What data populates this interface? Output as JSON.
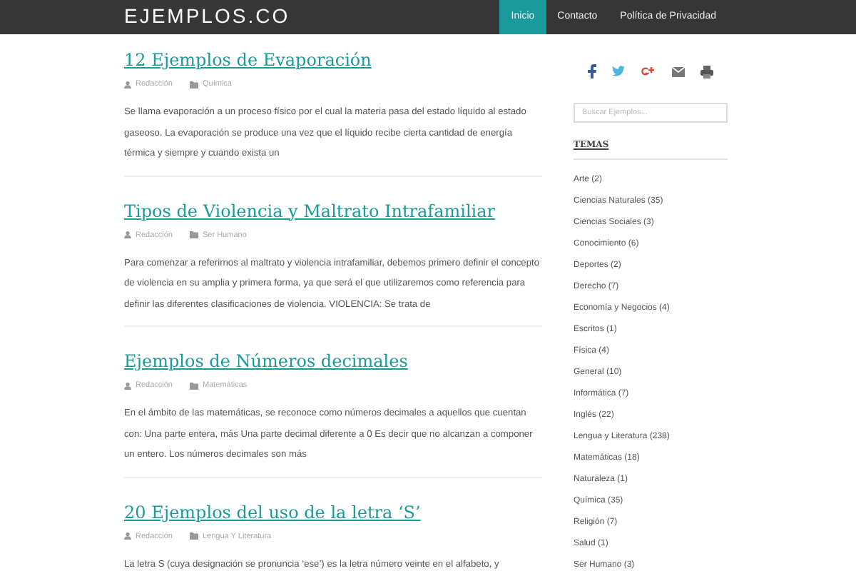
{
  "header": {
    "logo": "EJEMPLOS.CO",
    "nav": [
      {
        "label": "Inicio",
        "selected": true
      },
      {
        "label": "Contacto",
        "selected": false
      },
      {
        "label": "Política de Privacidad",
        "selected": false
      }
    ]
  },
  "posts": [
    {
      "title": "12 Ejemplos de Evaporación",
      "author": "Redacción",
      "category": "Química",
      "excerpt": "Se llama evaporación a un proceso físico por el cual la materia pasa del estado líquido al estado gaseoso. La evaporación se produce una vez que el líquido recibe cierta cantidad de energía térmica y siempre y cuando exista un"
    },
    {
      "title": "Tipos de Violencia y Maltrato Intrafamiliar",
      "author": "Redacción",
      "category": "Ser Humano",
      "excerpt": "Para comenzar a referirnos al maltrato y violencia intrafamiliar, debemos primero definir el concepto de violencia en su amplia y primera forma, ya que será el que utilizaremos como referencia para definir las diferentes clasificaciones de violencia. VIOLENCIA: Se trata de"
    },
    {
      "title": "Ejemplos de Números decimales",
      "author": "Redacción",
      "category": "Matemáticas",
      "excerpt": "En el ámbito de las matemáticas, se reconoce como números decimales a aquellos que cuentan con: Una parte entera, más Una parte decimal diferente a 0 Es decir que no alcanzan a componer un entero. Los números decimales son más"
    },
    {
      "title": "20 Ejemplos del uso de la letra ‘S’",
      "author": "Redacción",
      "category": "Lengua Y Literatura",
      "excerpt": "La letra S (cuya designación se pronuncia ‘ese’) es la letra número veinte en el alfabeto, y"
    }
  ],
  "sidebar": {
    "share": [
      {
        "kind": "facebook"
      },
      {
        "kind": "twitter"
      },
      {
        "kind": "googleplus"
      },
      {
        "kind": "email"
      },
      {
        "kind": "print"
      }
    ],
    "search": {
      "placeholder": "Buscar Ejemplos..."
    },
    "topics_title": "TEMAS",
    "topics": [
      "Arte (2)",
      "Ciencias Naturales (35)",
      "Ciencias Sociales (3)",
      "Conocimiento (6)",
      "Deportes (2)",
      "Derecho (7)",
      "Economía y Negocios (4)",
      "Escritos (1)",
      "Física (4)",
      "General (10)",
      "Informática (7)",
      "Inglés (22)",
      "Lengua y Literatura (238)",
      "Matemáticas (18)",
      "Naturaleza (1)",
      "Química (35)",
      "Religión (7)",
      "Salud (1)",
      "Ser Humano (3)"
    ]
  }
}
